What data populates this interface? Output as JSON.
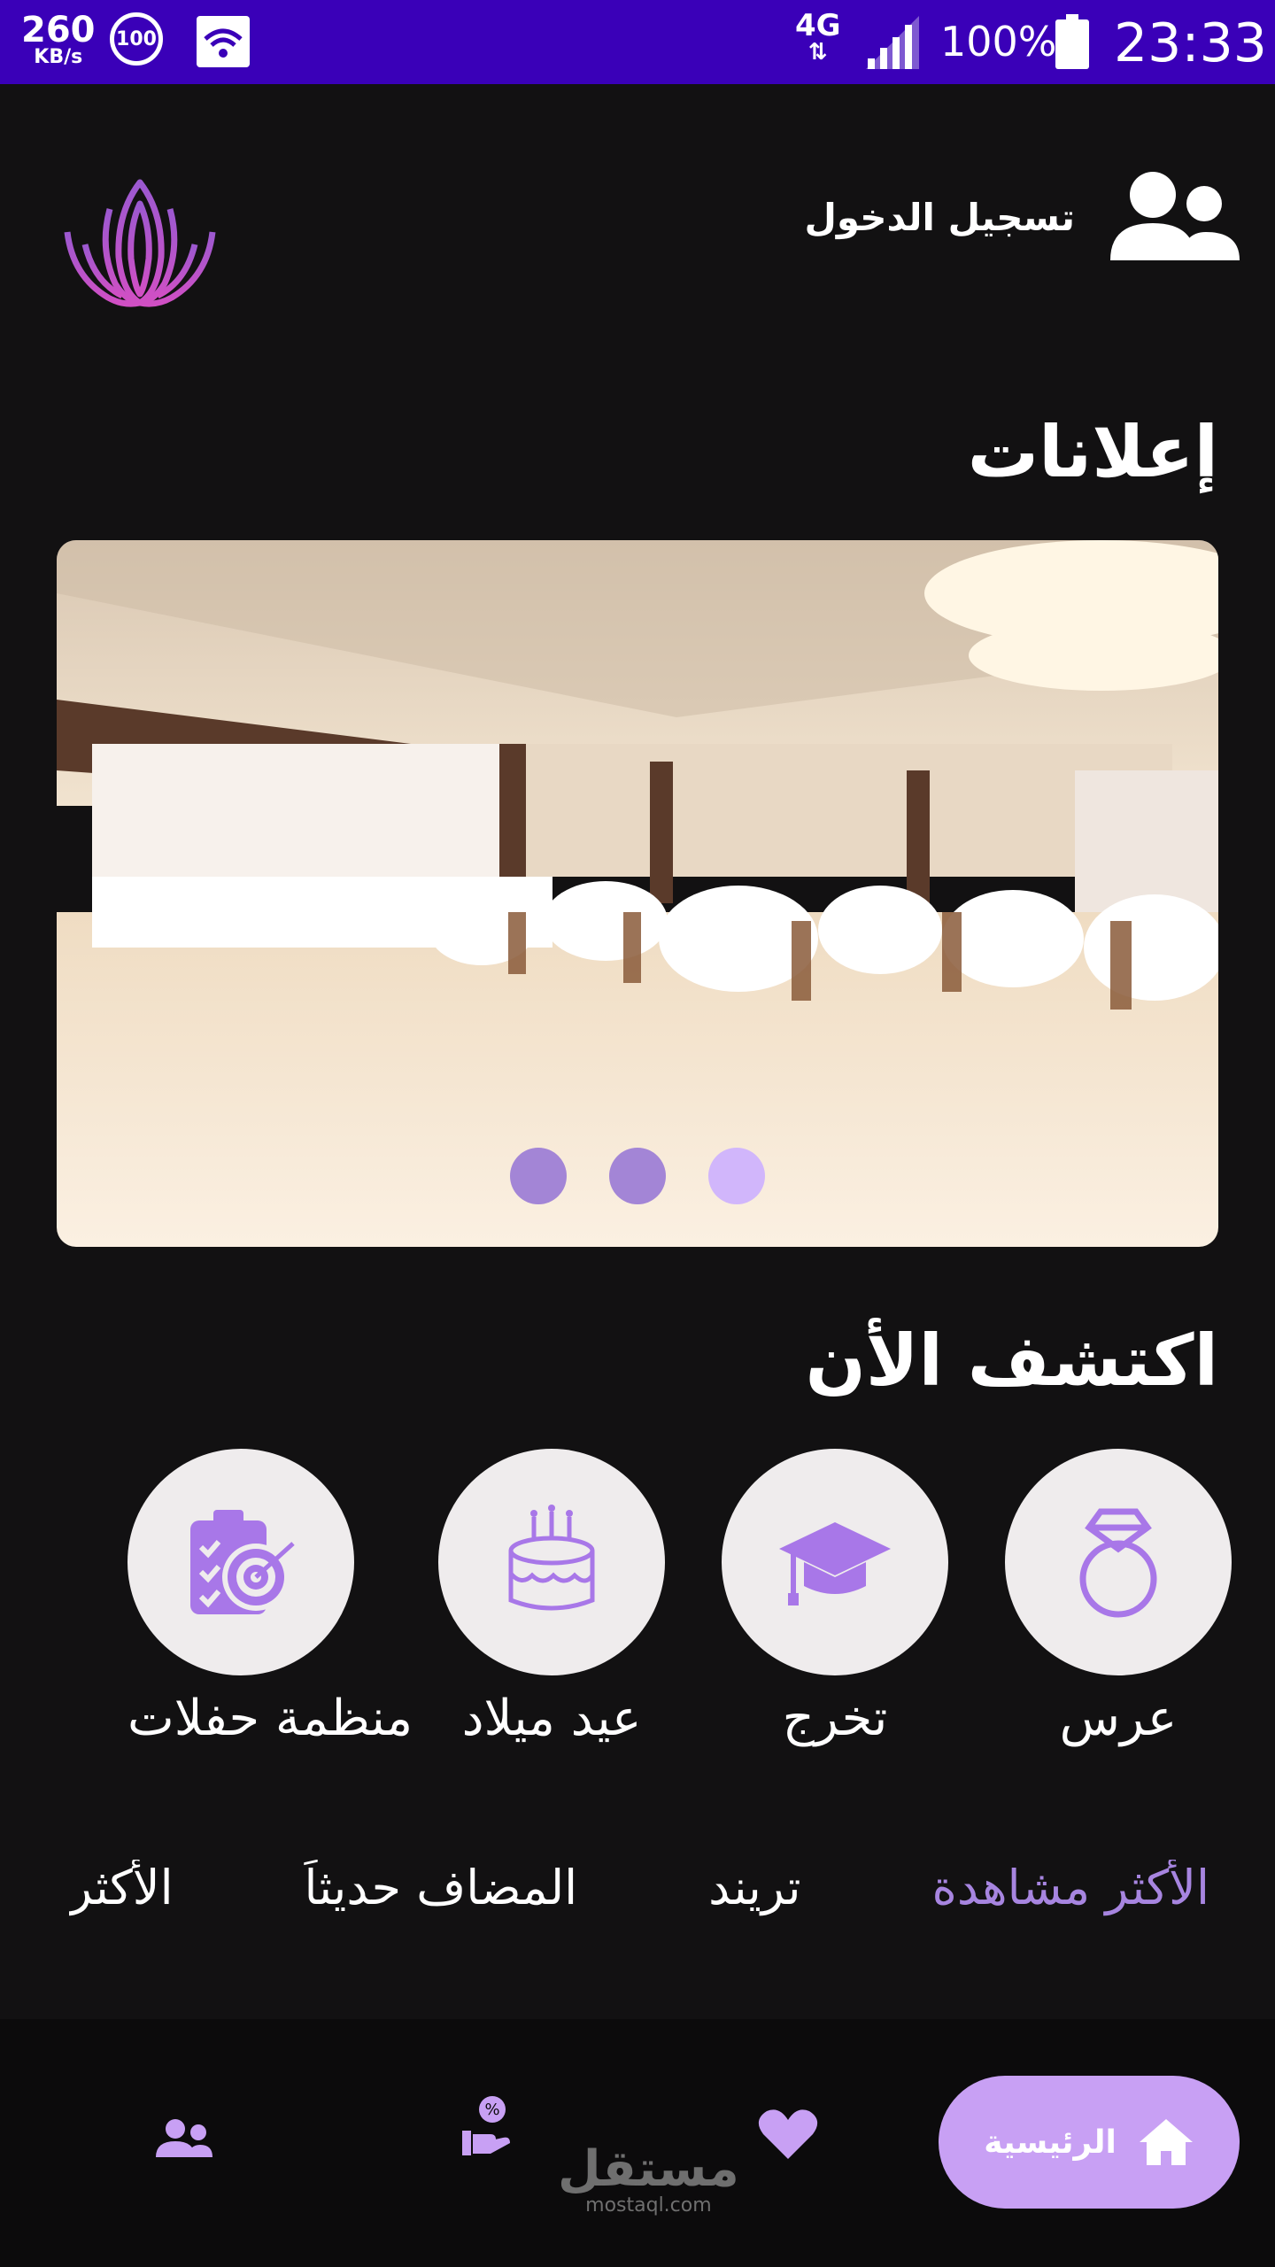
{
  "status_bar": {
    "net_speed": "260",
    "net_unit": "KB/s",
    "badge": "100",
    "network": "4G",
    "battery": "100%",
    "time": "23:33"
  },
  "header": {
    "login_label": "تسجيل الدخول"
  },
  "ads": {
    "title": "إعلانات",
    "slide_count": 3,
    "active_slide": 3
  },
  "discover": {
    "title": "اكتشف الأن",
    "categories": [
      {
        "label": "عرس",
        "icon": "ring-icon"
      },
      {
        "label": "تخرج",
        "icon": "graduation-cap-icon"
      },
      {
        "label": "عيد ميلاد",
        "icon": "cake-icon"
      },
      {
        "label": "منظمة حفلات",
        "icon": "clipboard-target-icon"
      }
    ]
  },
  "tabs": [
    {
      "label": "الأكثر مشاهدة",
      "active": true
    },
    {
      "label": "تريند",
      "active": false
    },
    {
      "label": "المضاف حديثاً",
      "active": false
    },
    {
      "label": "الأكثر",
      "active": false
    }
  ],
  "bottom_nav": {
    "home_label": "الرئيسية",
    "items": [
      "home-icon",
      "heart-icon",
      "offers-icon",
      "users-icon"
    ]
  },
  "watermark": {
    "line1": "مستقل",
    "line2": "mostaql.com"
  },
  "colors": {
    "status_bar": "#3a00b8",
    "background": "#121112",
    "accent": "#a785e0",
    "pill": "#c8a0f4"
  }
}
